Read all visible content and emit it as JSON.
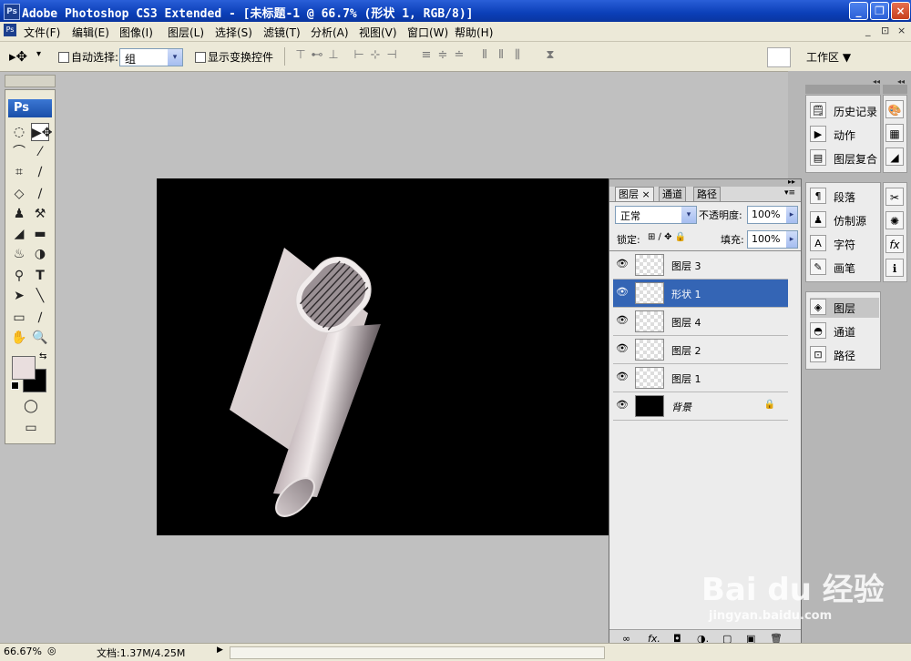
{
  "window": {
    "title": "Adobe Photoshop CS3 Extended - [未标题-1 @ 66.7% (形状 1, RGB/8)]",
    "app_badge": "Ps",
    "minimize_glyph": "_",
    "restore_glyph": "❐",
    "close_glyph": "×"
  },
  "menubar": {
    "items": [
      "文件(F)",
      "编辑(E)",
      "图像(I)",
      "图层(L)",
      "选择(S)",
      "滤镜(T)",
      "分析(A)",
      "视图(V)",
      "窗口(W)",
      "帮助(H)"
    ],
    "mdi_min": "_",
    "mdi_restore": "⊡",
    "mdi_close": "×"
  },
  "options": {
    "auto_select_label": "自动选择:",
    "auto_select_value": "组",
    "show_transform_label": "显示变换控件",
    "workspace_label": "工作区 ▼",
    "move_glyph": "▸✥",
    "dropdown_glyph": "▾"
  },
  "toolbox": {
    "badge": "Ps",
    "tools": [
      "◌",
      "▶✥",
      "⌒",
      "⁄",
      "⌗",
      "∕",
      "◇",
      "∕",
      "♟",
      "⚒",
      "◢",
      "▬",
      "♨",
      "◑",
      "⚲",
      "T",
      "➤",
      "╲",
      "▭",
      "∕",
      "✋",
      "🔍"
    ],
    "swap_glyph": "⇆",
    "mode_glyph": "◯",
    "screen_glyph": "▭"
  },
  "layers_panel": {
    "tabs": [
      "图层",
      "通道",
      "路径"
    ],
    "tab_close": "×",
    "blend_mode": "正常",
    "opacity_label": "不透明度:",
    "opacity_value": "100%",
    "lock_label": "锁定:",
    "lock_icons": "⊞ ∕ ✥ 🔒",
    "fill_label": "填充:",
    "fill_value": "100%",
    "layers": [
      {
        "name": "图层 3",
        "visible": true,
        "selected": false
      },
      {
        "name": "形状 1",
        "visible": true,
        "selected": true
      },
      {
        "name": "图层 4",
        "visible": true,
        "selected": false
      },
      {
        "name": "图层 2",
        "visible": true,
        "selected": false
      },
      {
        "name": "图层 1",
        "visible": true,
        "selected": false
      },
      {
        "name": "背景",
        "visible": true,
        "selected": false,
        "locked": true
      }
    ],
    "footer_icons": [
      "∞",
      "fx.",
      "◘",
      "◑.",
      "▢",
      "▣",
      "🗑"
    ],
    "eye_glyph": "👁",
    "lock_glyph": "🔒"
  },
  "dock": {
    "group1": [
      "历史记录",
      "动作",
      "图层复合"
    ],
    "group2": [
      "段落",
      "仿制源",
      "字符",
      "画笔"
    ],
    "group3": [
      "图层",
      "通道",
      "路径"
    ],
    "group1_icons": [
      "🗒",
      "▶",
      "▤"
    ],
    "group2_icons": [
      "¶",
      "♟",
      "A",
      "✎"
    ],
    "group3_icons": [
      "◈",
      "◓",
      "⊡"
    ],
    "side_icons": [
      "🎨",
      "▦",
      "◢",
      "✂",
      "✺",
      "fx",
      "ℹ"
    ],
    "collapse_glyph": "◂◂"
  },
  "statusbar": {
    "zoom": "66.67%",
    "doc_info": "文档:1.37M/4.25M",
    "arrow_glyph": "▶",
    "nav_glyph": "◎"
  },
  "watermark": {
    "brand": "Bai du 经验",
    "url": "jingyan.baidu.com"
  },
  "colors": {
    "foreground": "#e9dede",
    "background": "#000000",
    "selection": "#3465b5"
  }
}
